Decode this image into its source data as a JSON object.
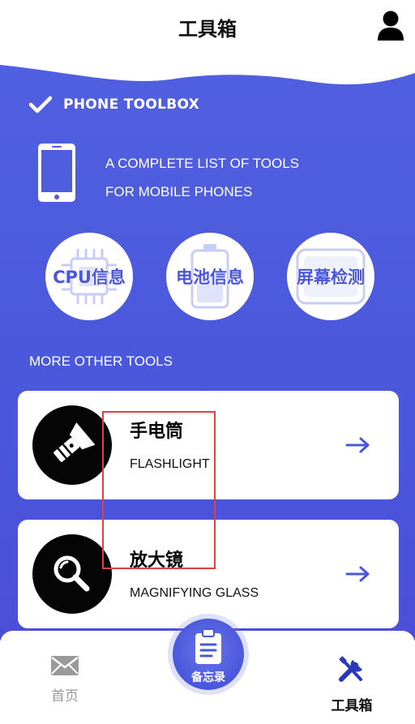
{
  "header": {
    "title": "工具箱"
  },
  "brand": {
    "name": "PHONE TOOLBOX"
  },
  "tagline": {
    "line1": "A COMPLETE LIST OF TOOLS",
    "line2": "FOR MOBILE PHONES"
  },
  "quick_tools": [
    {
      "label": "CPU信息",
      "icon": "cpu-chip-icon"
    },
    {
      "label": "电池信息",
      "icon": "battery-icon"
    },
    {
      "label": "屏幕检测",
      "icon": "screen-icon"
    }
  ],
  "section_title": "MORE OTHER TOOLS",
  "tools": [
    {
      "title": "手电筒",
      "subtitle": "FLASHLIGHT",
      "icon": "flashlight-icon"
    },
    {
      "title": "放大镜",
      "subtitle": "MAGNIFYING GLASS",
      "icon": "magnifier-icon"
    }
  ],
  "tabbar": {
    "home": "首页",
    "memo": "备忘录",
    "tools": "工具箱"
  },
  "colors": {
    "primary": "#4a57dc",
    "text": "#111111",
    "inactive": "#9a9a9a",
    "highlight": "#e04040"
  }
}
